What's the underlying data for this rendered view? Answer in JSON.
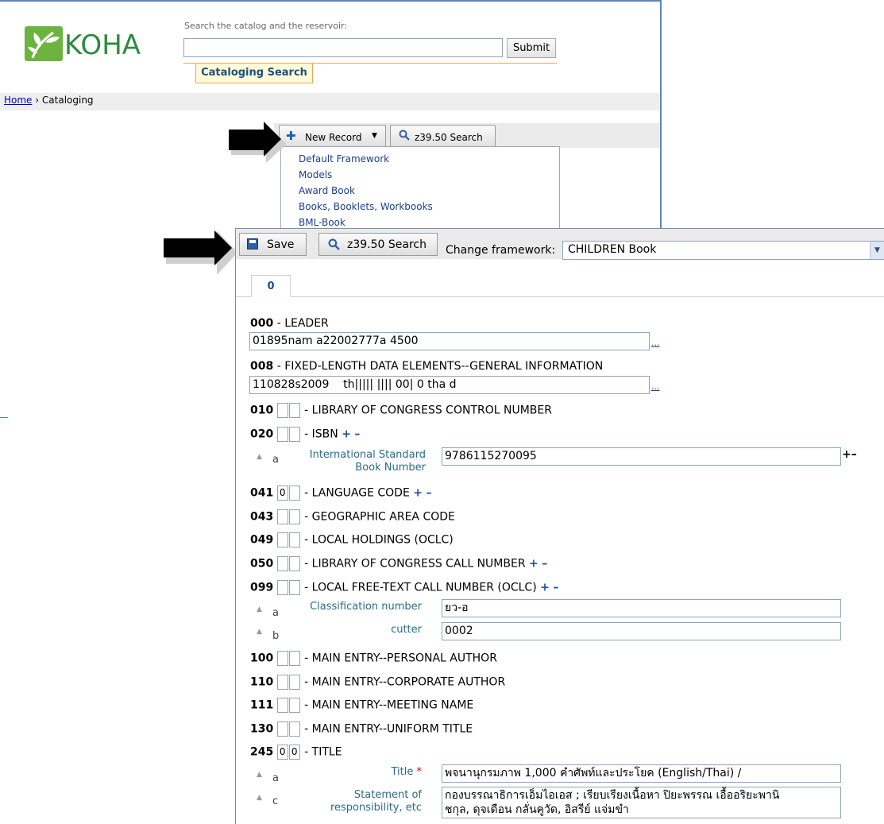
{
  "header": {
    "logo_text": "KOHA",
    "search_caption": "Search the catalog and the reservoir:",
    "search_value": "",
    "submit_label": "Submit",
    "tab_label": "Cataloging Search"
  },
  "breadcrumb": {
    "home": "Home",
    "separator": "›",
    "current": "Cataloging"
  },
  "toolbar": {
    "new_record_label": "New Record",
    "z3950_label": "z39.50 Search",
    "new_record_menu": [
      "Default Framework",
      "Models",
      "Award Book",
      "Books, Booklets, Workbooks",
      "BML-Book"
    ]
  },
  "editor": {
    "save_label": "Save",
    "z3950_label": "z39.50 Search",
    "change_framework_label": "Change framework:",
    "framework_value": "CHILDREN Book",
    "tab_label": "0",
    "dots": "...",
    "fields": {
      "f000": {
        "tag": "000",
        "name": "- LEADER",
        "value": "01895nam a22002777a 4500"
      },
      "f008": {
        "tag": "008",
        "name": "- FIXED-LENGTH DATA ELEMENTS--GENERAL INFORMATION",
        "value": "110828s2009    th||||| |||| 00| 0 tha d"
      },
      "f010": {
        "tag": "010",
        "name": "- LIBRARY OF CONGRESS CONTROL NUMBER"
      },
      "f020": {
        "tag": "020",
        "name": "- ISBN",
        "sub_a_code": "a",
        "sub_a_label_1": "International Standard",
        "sub_a_label_2": "Book Number",
        "sub_a_value": "9786115270095"
      },
      "f041": {
        "tag": "041",
        "ind1": "0",
        "name": "- LANGUAGE CODE"
      },
      "f043": {
        "tag": "043",
        "name": "- GEOGRAPHIC AREA CODE"
      },
      "f049": {
        "tag": "049",
        "name": "- LOCAL HOLDINGS (OCLC)"
      },
      "f050": {
        "tag": "050",
        "name": "- LIBRARY OF CONGRESS CALL NUMBER"
      },
      "f099": {
        "tag": "099",
        "name": "- LOCAL FREE-TEXT CALL NUMBER (OCLC)",
        "sub_a_code": "a",
        "sub_a_label": "Classification number",
        "sub_a_value": "ยว-อ",
        "sub_b_code": "b",
        "sub_b_label": "cutter",
        "sub_b_value": "0002"
      },
      "f100": {
        "tag": "100",
        "name": "- MAIN ENTRY--PERSONAL AUTHOR"
      },
      "f110": {
        "tag": "110",
        "name": "- MAIN ENTRY--CORPORATE AUTHOR"
      },
      "f111": {
        "tag": "111",
        "name": "- MAIN ENTRY--MEETING NAME"
      },
      "f130": {
        "tag": "130",
        "name": "- MAIN ENTRY--UNIFORM TITLE"
      },
      "f245": {
        "tag": "245",
        "ind1": "0",
        "ind2": "0",
        "name": "- TITLE",
        "sub_a_code": "a",
        "sub_a_label": "Title",
        "sub_a_value": "พจนานุกรมภาพ 1,000 คำศัพท์และประโยค (English/Thai) /",
        "sub_c_code": "c",
        "sub_c_label_1": "Statement of",
        "sub_c_label_2": "responsibility, etc",
        "sub_c_value_1": "กองบรรณาธิการเอ็มไอเอส ; เรียบเรียงเนื้อหา ปิยะพรรณ เอื้ออริยะพานิ",
        "sub_c_value_2": "ชกุล, ดุจเดือน กลั่นคูวัด, อิสรีย์ แจ่มขำ"
      }
    },
    "plus": "+",
    "minus": "–",
    "required_mark": "*"
  }
}
